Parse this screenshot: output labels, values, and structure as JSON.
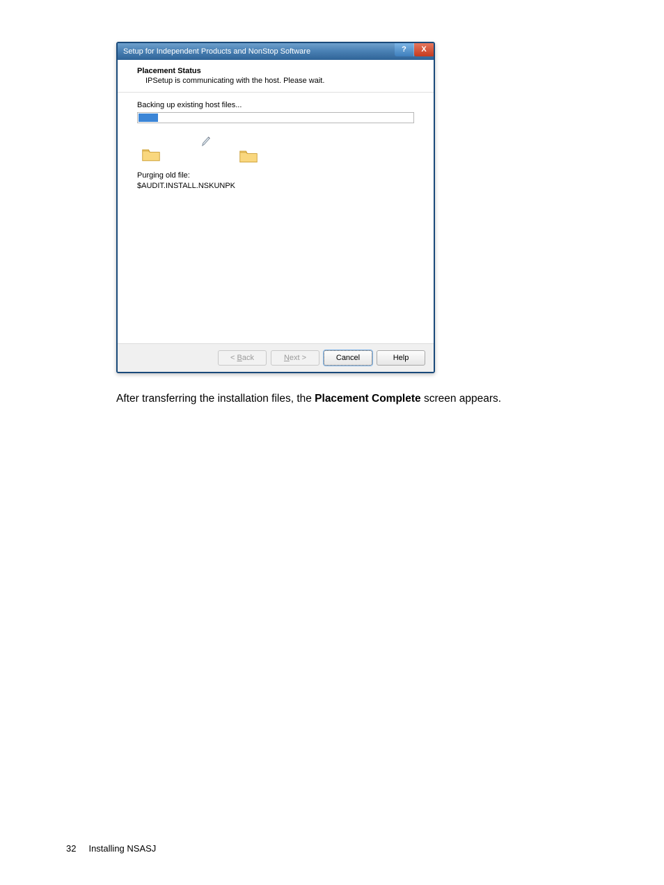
{
  "dialog": {
    "title": "Setup for Independent Products and NonStop Software",
    "header": {
      "title": "Placement Status",
      "subtitle": "IPSetup is communicating with the host. Please wait."
    },
    "backup_label": "Backing up existing host files...",
    "progress_percent": 7,
    "purge": {
      "label": "Purging old file:",
      "path": "$AUDIT.INSTALL.NSKUNPK"
    },
    "buttons": {
      "back": "< Back",
      "next": "Next >",
      "cancel": "Cancel",
      "help": "Help"
    },
    "win": {
      "help": "?",
      "close": "X"
    }
  },
  "caption": {
    "pre": "After transferring the installation files, the ",
    "bold": "Placement Complete",
    "post": " screen appears."
  },
  "footer": {
    "page": "32",
    "section": "Installing NSASJ"
  }
}
